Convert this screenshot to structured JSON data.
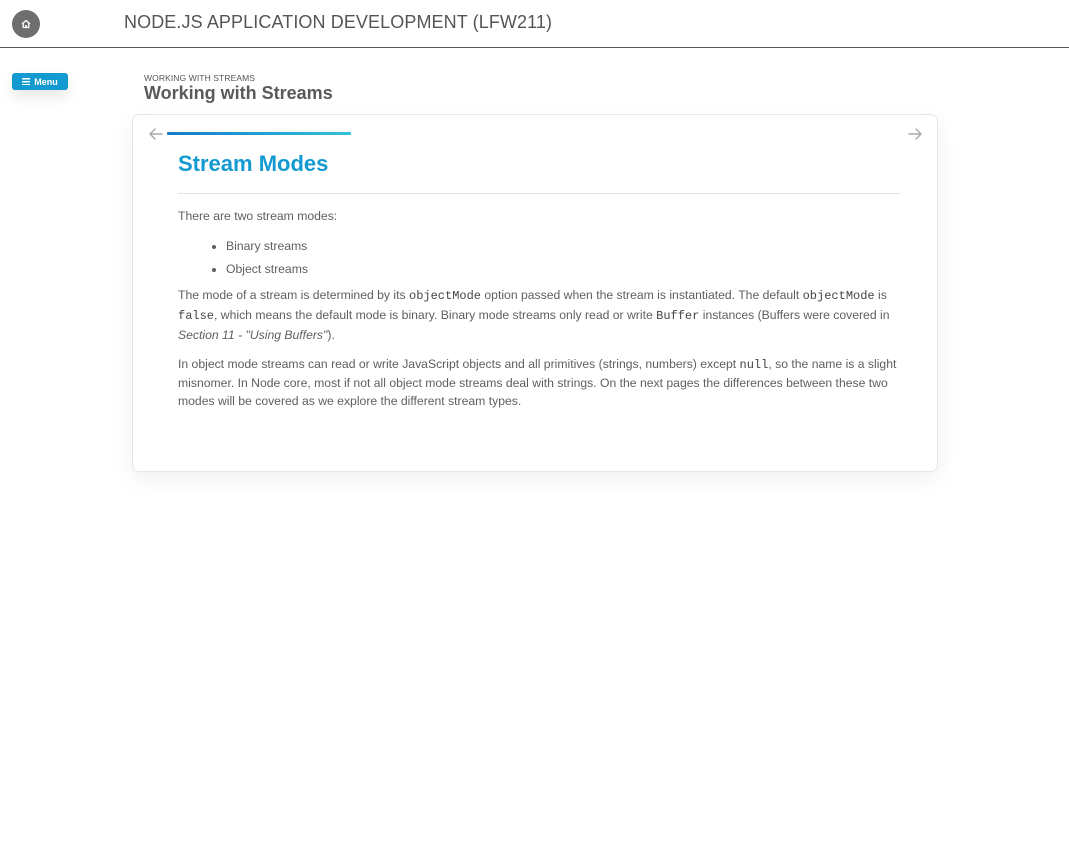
{
  "header": {
    "course_title": "NODE.JS APPLICATION DEVELOPMENT (LFW211)",
    "home_icon": "home-icon"
  },
  "sidebar": {
    "menu_label": "Menu",
    "menu_icon": "hamburger-icon"
  },
  "breadcrumb": "WORKING WITH STREAMS",
  "page_title": "Working with Streams",
  "card": {
    "prev_icon": "arrow-left-icon",
    "next_icon": "arrow-right-icon",
    "section_title": "Stream Modes",
    "intro": "There are two stream modes:",
    "modes": [
      "Binary streams",
      "Object streams"
    ],
    "p1": {
      "t1": "The mode of a stream is determined by its ",
      "c1": "objectMode",
      "t2": " option passed when the stream is instantiated. The default ",
      "c2": "objectMode",
      "t3": " is ",
      "c3": "false",
      "t4": ", which means the default mode is binary. Binary mode streams only read or write ",
      "c4": "Buffer",
      "t5": " instances (Buffers were covered in ",
      "em": "Section 11 - \"Using Buffers\"",
      "t6": ")."
    },
    "p2": {
      "t1": "In object mode streams can read or write JavaScript objects and all primitives (strings, numbers) except ",
      "c1": "null",
      "t2": ", so the name is a slight misnomer. In Node core, most if not all object mode streams deal with strings. On the next pages the differences between these two modes will be covered as we explore the different stream types."
    }
  },
  "colors": {
    "accent": "#139bd1",
    "progress_start": "#1479c9",
    "progress_end": "#35c1dd"
  }
}
